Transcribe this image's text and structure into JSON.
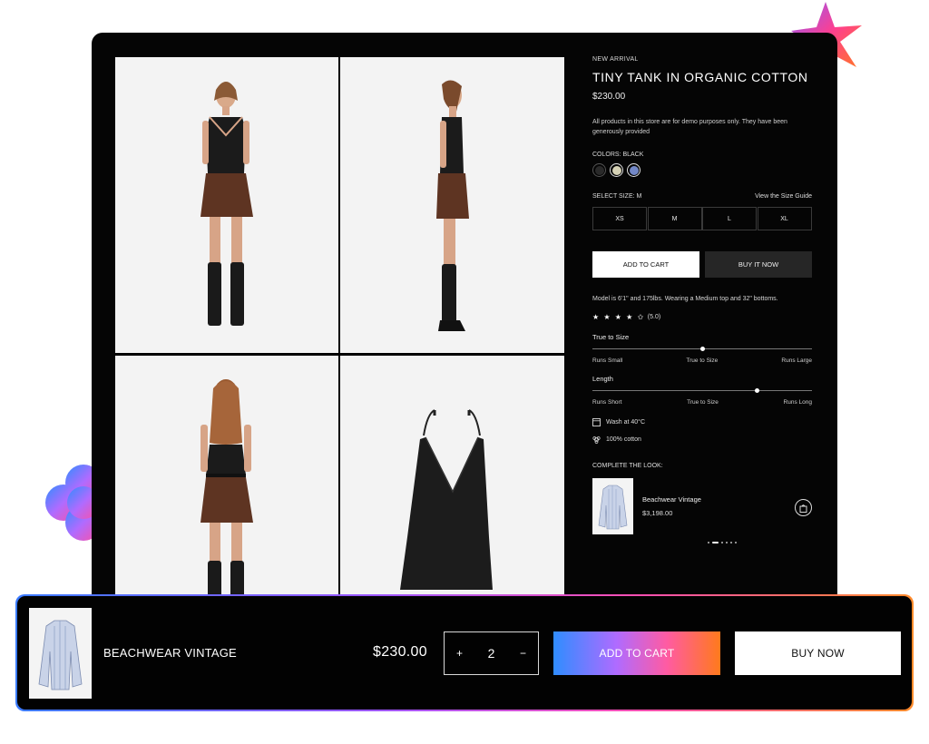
{
  "product": {
    "eyebrow": "NEW ARRIVAL",
    "title": "TINY TANK IN ORGANIC COTTON",
    "price": "$230.00",
    "notice": "All products in this store are for demo purposes only. They have been generously provided",
    "colors_label": "COLORS: BLACK",
    "colors": [
      {
        "name": "black",
        "hex": "#2a2a2a"
      },
      {
        "name": "beige",
        "hex": "#d6d2b6"
      },
      {
        "name": "blue",
        "hex": "#7388c7"
      }
    ],
    "select_size_label": "SELECT SIZE: M",
    "size_guide_link": "View the Size Guide",
    "sizes": [
      "XS",
      "M",
      "L",
      "XL"
    ],
    "add_to_cart": "ADD TO CART",
    "buy_it_now": "BUY IT NOW",
    "model_note": "Model is 6'1\" and 175lbs. Wearing a Medium top and 32\" bottoms.",
    "stars": "★ ★ ★ ★ ✩",
    "rating_value": "(5.0)",
    "rating_score": 4.5,
    "fit": [
      {
        "title": "True to Size",
        "labels": [
          "Runs Small",
          "True to Size",
          "Runs Large"
        ],
        "value": 0.5
      },
      {
        "title": "Length",
        "labels": [
          "Runs Short",
          "True to Size",
          "Runs Long"
        ],
        "value": 0.75
      }
    ],
    "care": [
      {
        "icon": "wash-icon",
        "text": "Wash at 40°C"
      },
      {
        "icon": "cotton-icon",
        "text": "100% cotton"
      }
    ],
    "complete_label": "COMPLETE THE LOOK:",
    "look_item": {
      "name": "Beachwear Vintage",
      "price": "$3,198.00"
    }
  },
  "sticky_bar": {
    "name": "BEACHWEAR VINTAGE",
    "price": "$230.00",
    "qty_minus": "+",
    "qty_value": "2",
    "qty_plus": "−",
    "add_to_cart": "ADD TO CART",
    "buy_now": "BUY NOW"
  },
  "colors": {
    "background": "#050505",
    "tile": "#f3f3f3",
    "gradient": [
      "#2f8dff",
      "#b06bff",
      "#ff5ba2",
      "#ff7a1c"
    ]
  }
}
